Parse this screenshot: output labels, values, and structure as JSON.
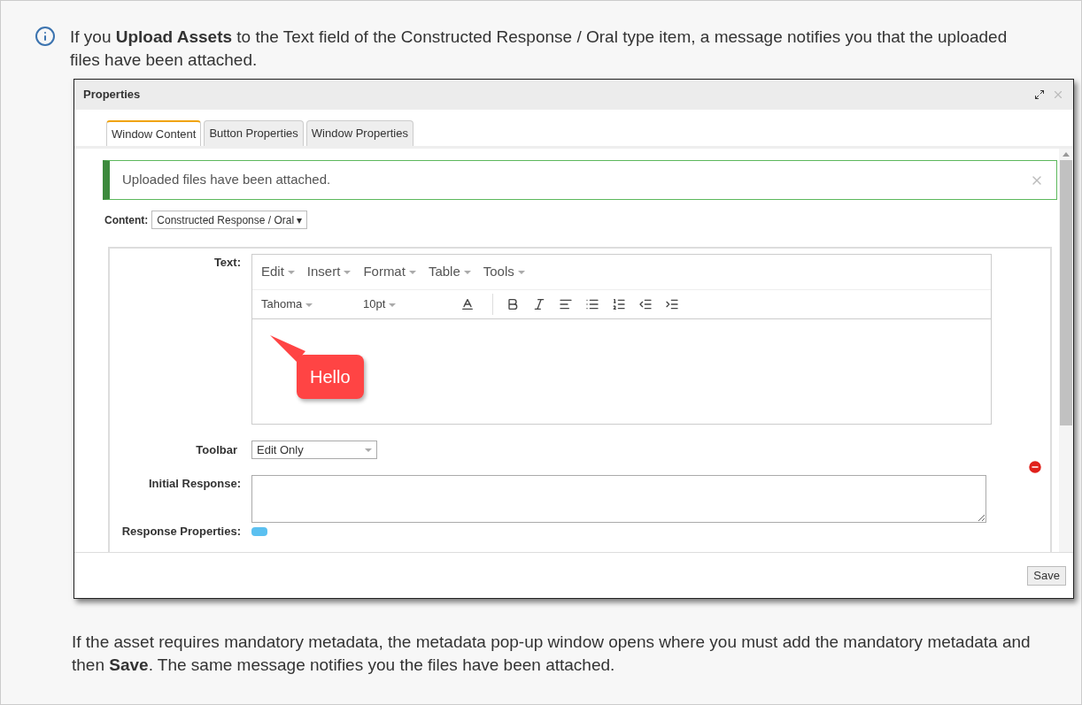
{
  "intro": "If you **Upload Assets** to the Text field of the Constructed Response / Oral type item, a message notifies you that the uploaded files have been attached.",
  "dialog": {
    "title": "Properties",
    "tabs": [
      {
        "label": "Window Content",
        "selected": true
      },
      {
        "label": "Button Properties",
        "selected": false
      },
      {
        "label": "Window Properties",
        "selected": false
      }
    ],
    "alert": "Uploaded files have been attached.",
    "content": {
      "label": "Content:",
      "value": "Constructed Response / Oral ▾"
    },
    "text_label": "Text:",
    "menus": [
      "Edit",
      "Insert",
      "Format",
      "Table",
      "Tools"
    ],
    "font": "Tahoma",
    "size": "10pt",
    "callout": "Hello",
    "toolbar": {
      "label": "Toolbar",
      "value": "Edit Only"
    },
    "initial_response": "Initial Response:",
    "response_properties": "Response Properties:",
    "save": "Save"
  },
  "outro": "If the asset requires mandatory metadata, the metadata pop-up window opens where you must add the mandatory metadata and then **Save**. The same message notifies you the files have been attached."
}
